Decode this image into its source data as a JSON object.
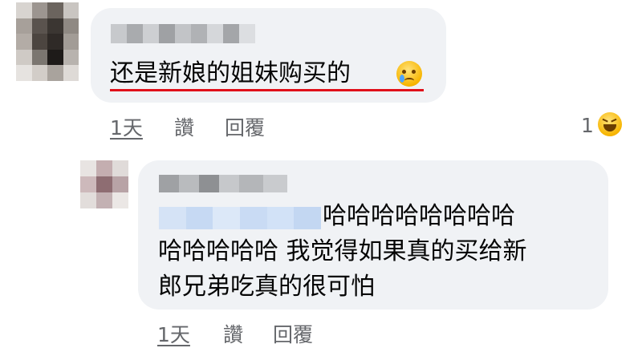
{
  "comment1": {
    "text": "还是新娘的姐妹购买的",
    "emoji": "crying-face",
    "time_label": "1天",
    "like_label": "讚",
    "reply_label": "回覆",
    "reaction_count": "1",
    "reaction_emoji": "laughing-face"
  },
  "reply1": {
    "line1": "哈哈哈哈哈哈哈哈",
    "line2": "哈哈哈哈哈 我觉得如果真的买给新",
    "line3": "郎兄弟吃真的很可怕",
    "time_label": "1天",
    "like_label": "讚",
    "reply_label": "回覆"
  },
  "colors": {
    "bubble": "#f0f2f5",
    "underline": "#e0101a",
    "mention_highlight": "#cfe0f7",
    "meta_text": "#65676b"
  }
}
